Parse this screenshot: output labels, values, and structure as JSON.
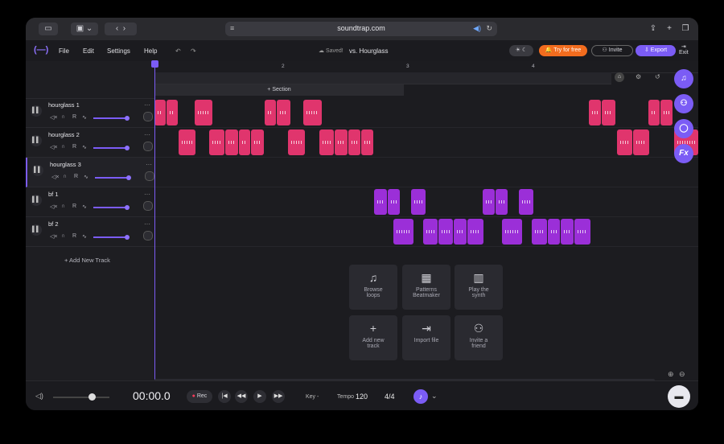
{
  "browser": {
    "url": "soundtrap.com"
  },
  "menu": {
    "file": "File",
    "edit": "Edit",
    "settings": "Settings",
    "help": "Help"
  },
  "status": {
    "saved": "Saved!",
    "project": "vs. Hourglass"
  },
  "actions": {
    "try": "Try for free",
    "invite": "Invite",
    "export": "Export",
    "exit": "Exit"
  },
  "ruler": [
    "2",
    "3",
    "4"
  ],
  "section_label": "+ Section",
  "tracks": [
    {
      "name": "hourglass 1",
      "color": "#e0356d"
    },
    {
      "name": "hourglass 2",
      "color": "#e0356d"
    },
    {
      "name": "hourglass 3",
      "color": "#e0356d"
    },
    {
      "name": "bf 1",
      "color": "#9b2fd8"
    },
    {
      "name": "bf 2",
      "color": "#9b2fd8"
    }
  ],
  "track_controls": {
    "record": "R"
  },
  "add_track": "+ Add New Track",
  "tiles": [
    {
      "l1": "Browse",
      "l2": "loops",
      "icon": "music-note-icon"
    },
    {
      "l1": "Patterns",
      "l2": "Beatmaker",
      "icon": "grid-icon"
    },
    {
      "l1": "Play the",
      "l2": "synth",
      "icon": "piano-icon"
    },
    {
      "l1": "Add new",
      "l2": "track",
      "icon": "plus-icon"
    },
    {
      "l1": "Import file",
      "l2": "",
      "icon": "import-icon"
    },
    {
      "l1": "Invite a",
      "l2": "friend",
      "icon": "add-user-icon"
    }
  ],
  "side_buttons": [
    "♫",
    "⚇",
    "◯",
    "Fx"
  ],
  "transport": {
    "time": "00:00.0",
    "rec": "Rec",
    "key": "Key -",
    "tempo_label": "Tempo",
    "tempo": "120",
    "signature": "4/4"
  }
}
